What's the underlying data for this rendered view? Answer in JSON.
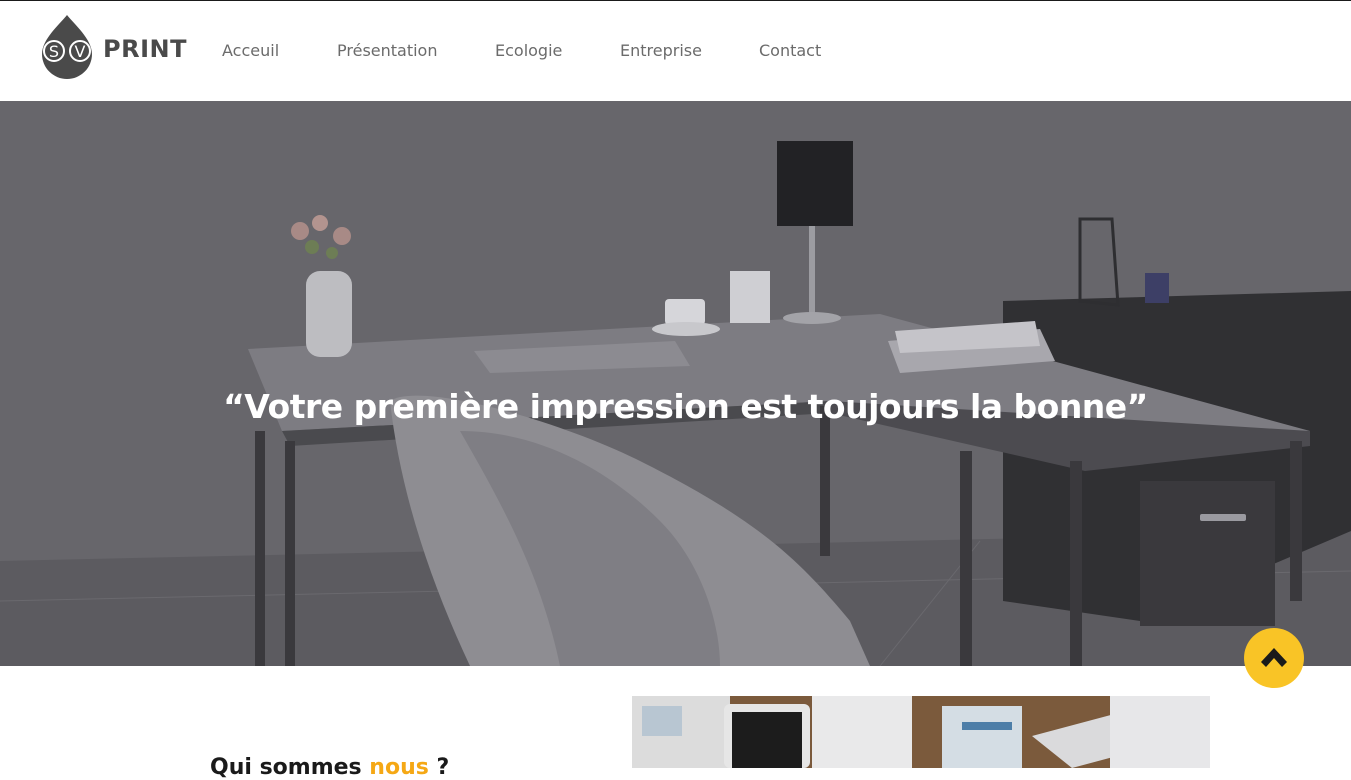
{
  "brand": {
    "logo_letters": [
      "S",
      "V"
    ],
    "name": "PRINT"
  },
  "nav": {
    "items": [
      {
        "label": "Acceuil"
      },
      {
        "label": "Présentation"
      },
      {
        "label": "Ecologie"
      },
      {
        "label": "Entreprise"
      },
      {
        "label": "Contact"
      }
    ]
  },
  "hero": {
    "quote": "“Votre première impression est toujours la bonne”"
  },
  "about": {
    "title_start": "Qui sommes ",
    "title_accent": "nous",
    "title_end": " ?"
  },
  "scroll_top": {
    "icon": "chevron-up-icon"
  },
  "colors": {
    "accent": "#f5a815",
    "button": "#f9c426",
    "logo": "#4a4a4a",
    "nav_text": "#6b6b6b"
  },
  "images": {
    "hero": "office-desk-photo",
    "about": "desk-documents-tablet-photo"
  }
}
